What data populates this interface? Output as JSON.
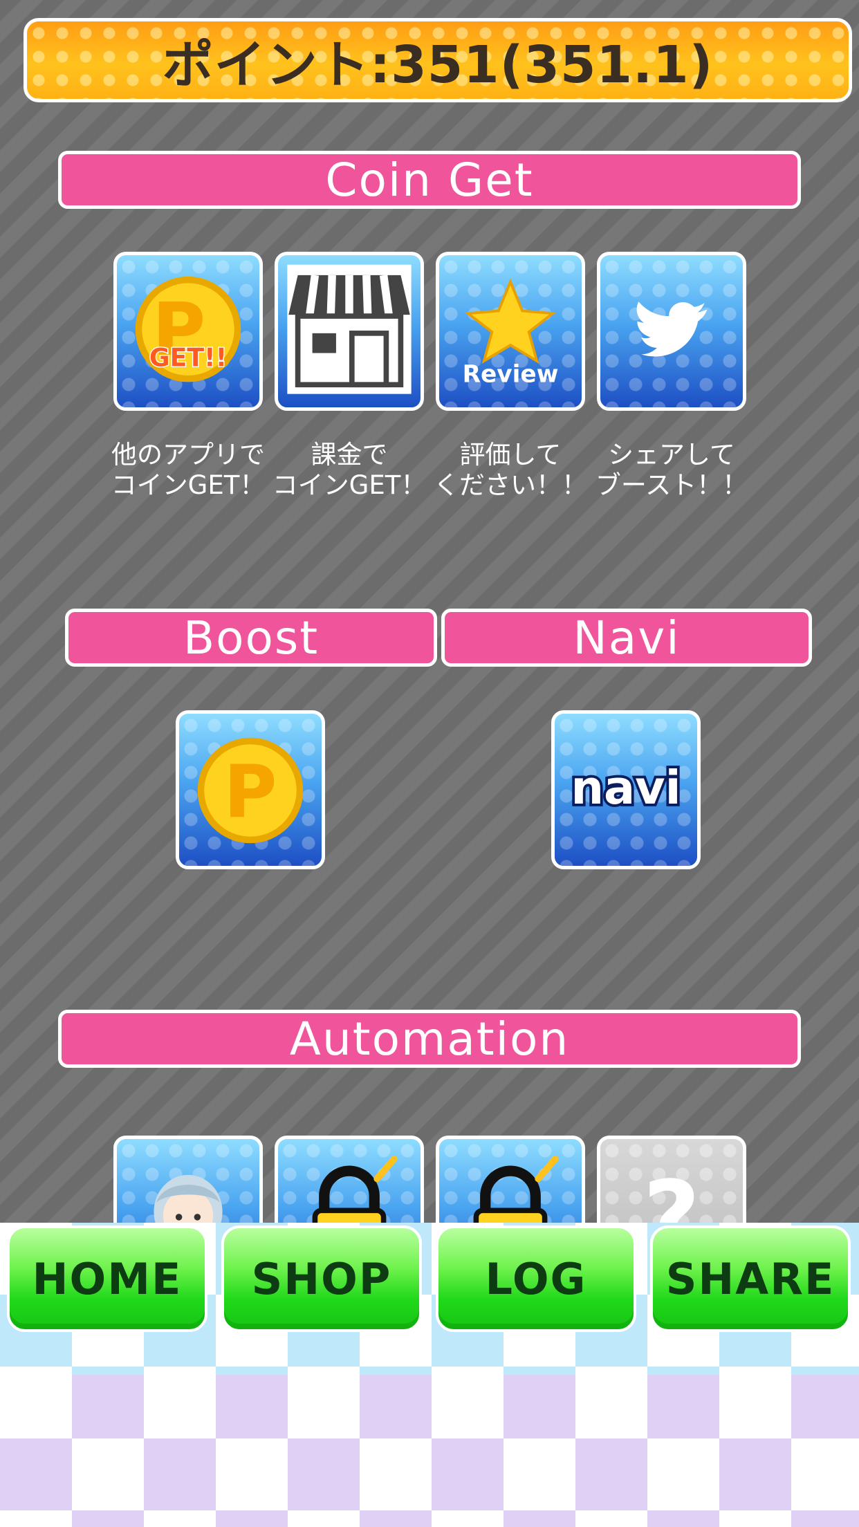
{
  "points": {
    "text": "ポイント:351(351.1)"
  },
  "sections": {
    "coin_get": "Coin Get",
    "boost": "Boost",
    "navi": "Navi",
    "automation": "Automation"
  },
  "coin_get_tiles": [
    {
      "icon": "coin-get-icon",
      "label": "GET!!",
      "caption_line1": "他のアプリで",
      "caption_line2": "コインGET！"
    },
    {
      "icon": "shop-icon",
      "caption_line1": "課金で",
      "caption_line2": "コインGET！"
    },
    {
      "icon": "review-star-icon",
      "label": "Review",
      "caption_line1": "評価して",
      "caption_line2": "ください！！"
    },
    {
      "icon": "twitter-bird-icon",
      "caption_line1": "シェアして",
      "caption_line2": "ブースト！！"
    }
  ],
  "boost_tile": {
    "icon": "coin-p-icon",
    "letter": "P"
  },
  "navi_tile": {
    "icon": "navi-logo-icon",
    "label": "navi"
  },
  "automation_tiles": [
    {
      "icon": "character-icon"
    },
    {
      "icon": "locked-icon"
    },
    {
      "icon": "locked-icon"
    },
    {
      "icon": "unknown-question-icon",
      "label": "?"
    }
  ],
  "nav": {
    "home": "HOME",
    "shop": "SHOP",
    "log": "LOG",
    "share": "SHARE"
  },
  "colors": {
    "section_header": "#f0559b",
    "points_bar": "#ffb114",
    "nav_button": "#21d91a"
  }
}
